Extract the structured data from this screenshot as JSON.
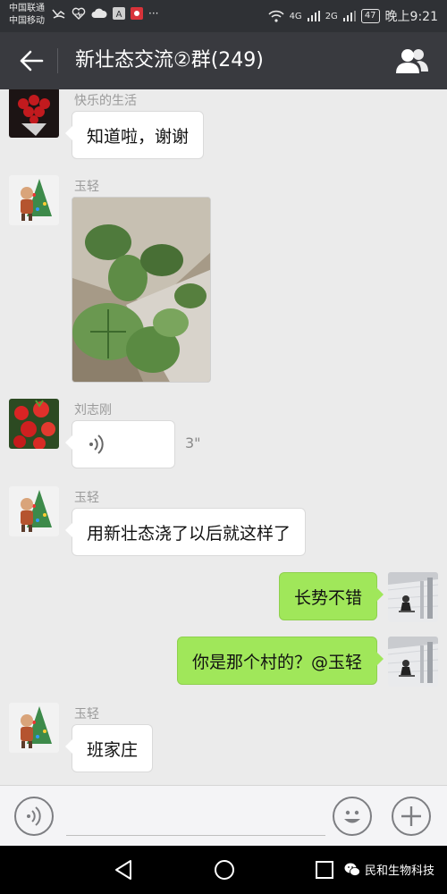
{
  "status_bar": {
    "carrier_1": "中国联通",
    "carrier_2": "中国移动",
    "signal_1": "4G",
    "signal_2": "2G",
    "battery": "47",
    "time": "晚上9:21"
  },
  "header": {
    "title": "新壮态交流②群(249)"
  },
  "messages": [
    {
      "sender": "快乐的生活",
      "text": "知道啦，谢谢"
    },
    {
      "sender": "玉轻",
      "type": "image"
    },
    {
      "sender": "刘志刚",
      "type": "voice",
      "duration": "3\""
    },
    {
      "sender": "玉轻",
      "text": "用新壮态浇了以后就这样了"
    },
    {
      "self": true,
      "text": "长势不错"
    },
    {
      "self": true,
      "text": "你是那个村的？@玉轻"
    },
    {
      "sender": "玉轻",
      "text": "班家庄"
    }
  ],
  "input": {
    "placeholder": ""
  },
  "watermark": {
    "text": "民和生物科技"
  },
  "colors": {
    "header_bg": "#393a3f",
    "self_bubble": "#a0e75a",
    "chat_bg": "#ebebeb"
  }
}
